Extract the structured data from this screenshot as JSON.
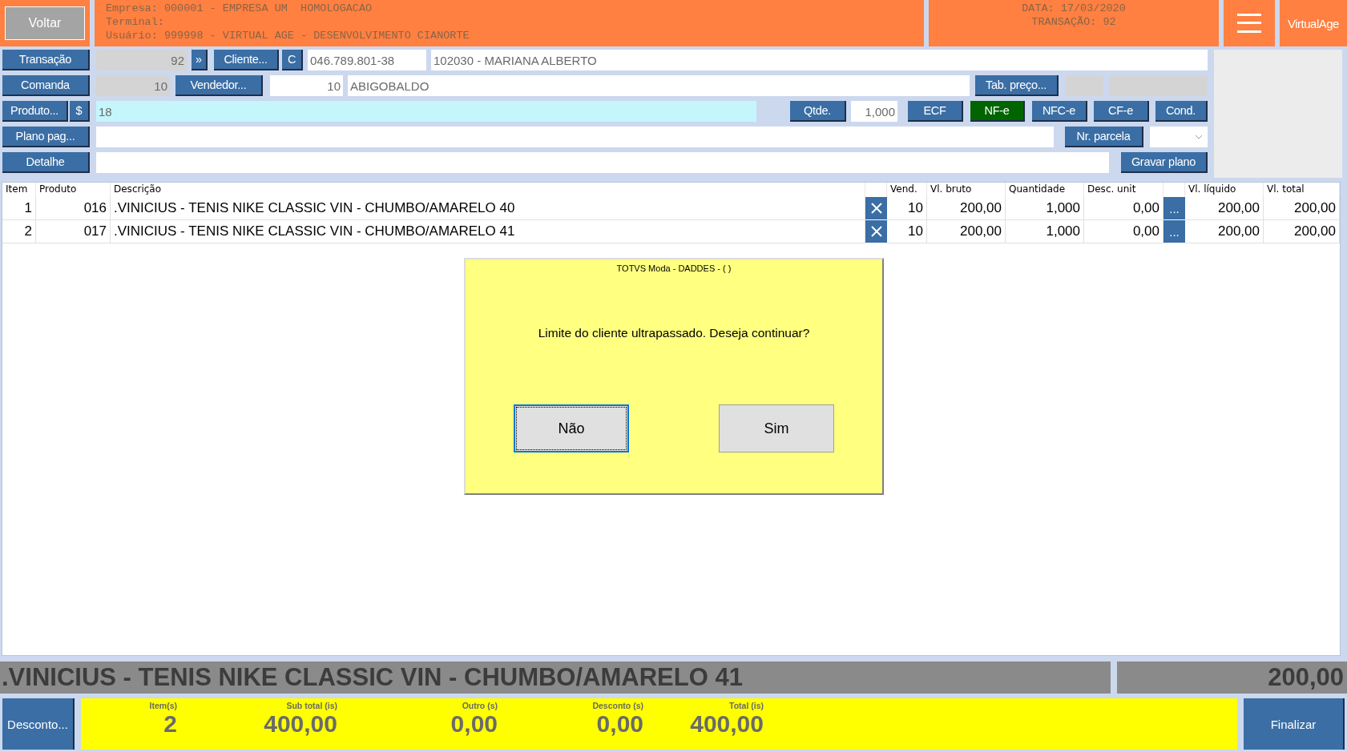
{
  "header": {
    "back_button": "Voltar",
    "info_lines": [
      "Empresa: 000001 - EMPRESA UM  HOMOLOGACAO",
      "Terminal:",
      "Usuário: 999998 - VIRTUAL AGE - DESENVOLVIMENTO CIANORTE"
    ],
    "date_lines": [
      "DATA: 17/03/2020",
      "TRANSAÇÃO: 92"
    ],
    "brand": "VirtualAge"
  },
  "form_rows": [
    {
      "items": [
        {
          "kind": "button",
          "label": "Transação",
          "selected": false
        },
        {
          "kind": "field",
          "value": "92",
          "disabled": true,
          "focused": false
        },
        {
          "kind": "button",
          "label": "»",
          "selected": false
        },
        {
          "kind": "button",
          "label": "Cliente...",
          "selected": false
        },
        {
          "kind": "button",
          "label": "C",
          "selected": false
        },
        {
          "kind": "field",
          "value": "046.789.801-38",
          "disabled": false,
          "focused": false
        },
        {
          "kind": "field",
          "value": "102030 - MARIANA ALBERTO",
          "disabled": false,
          "focused": false
        }
      ]
    },
    {
      "items": [
        {
          "kind": "button",
          "label": "Comanda",
          "selected": false
        },
        {
          "kind": "field",
          "value": "10",
          "disabled": true,
          "focused": false
        },
        {
          "kind": "button",
          "label": "Vendedor...",
          "selected": false
        },
        {
          "kind": "field",
          "value": "10",
          "disabled": false,
          "focused": false
        },
        {
          "kind": "field",
          "value": "ABIGOBALDO",
          "disabled": false,
          "focused": false
        },
        {
          "kind": "button",
          "label": "Tab. preço...",
          "selected": false
        },
        {
          "kind": "field",
          "disabled": true,
          "focused": false
        },
        {
          "kind": "field",
          "disabled": true,
          "focused": false
        }
      ]
    },
    {
      "items": [
        {
          "kind": "button",
          "label": "Produto...",
          "selected": false
        },
        {
          "kind": "button",
          "label": "$",
          "selected": false
        },
        {
          "kind": "field",
          "value": "18",
          "disabled": false,
          "focused": true
        },
        {
          "kind": "button",
          "label": "Qtde.",
          "selected": false
        },
        {
          "kind": "field",
          "value": "1,000",
          "disabled": false,
          "focused": false
        },
        {
          "kind": "button",
          "label": "ECF",
          "selected": false
        },
        {
          "kind": "button",
          "label": "NF-e",
          "selected": true
        },
        {
          "kind": "button",
          "label": "NFC-e",
          "selected": false
        },
        {
          "kind": "button",
          "label": "CF-e",
          "selected": false
        },
        {
          "kind": "button",
          "label": "Cond.",
          "selected": false
        }
      ]
    },
    {
      "items": [
        {
          "kind": "button",
          "label": "Plano pag...",
          "selected": false
        },
        {
          "kind": "field",
          "disabled": false,
          "focused": false
        },
        {
          "kind": "button",
          "label": "Nr. parcela",
          "selected": false
        },
        {
          "kind": "dropdown"
        }
      ]
    },
    {
      "items": [
        {
          "kind": "button",
          "label": "Detalhe",
          "selected": false
        },
        {
          "kind": "field",
          "disabled": false,
          "focused": false
        },
        {
          "kind": "button",
          "label": "Gravar plano",
          "selected": false
        }
      ]
    }
  ],
  "table": {
    "columns": [
      "Item",
      "Produto",
      "Descrição",
      "Vend.",
      "Vl. bruto",
      "Quantidade",
      "Desc. unit",
      "Vl. líquido",
      "Vl. total"
    ],
    "rows": [
      {
        "item": "1",
        "product": "016",
        "description": ".VINICIUS - TENIS NIKE CLASSIC VIN - CHUMBO/AMARELO 40",
        "vend": "10",
        "gross": "200,00",
        "qty": "1,000",
        "discount": "0,00",
        "detail_button": "...",
        "net": "200,00",
        "total": "200,00"
      },
      {
        "item": "2",
        "product": "017",
        "description": ".VINICIUS - TENIS NIKE CLASSIC VIN - CHUMBO/AMARELO 41",
        "vend": "10",
        "gross": "200,00",
        "qty": "1,000",
        "discount": "0,00",
        "detail_button": "...",
        "net": "200,00",
        "total": "200,00"
      }
    ]
  },
  "dialog": {
    "title": "TOTVS Moda - DADDES - (  )",
    "message": "Limite do cliente ultrapassado. Deseja continuar?",
    "buttons": [
      {
        "label": "Não",
        "focused": true
      },
      {
        "label": "Sim",
        "focused": false
      }
    ]
  },
  "status_line": {
    "description": ".VINICIUS - TENIS NIKE CLASSIC VIN - CHUMBO/AMARELO 41",
    "value": "200,00"
  },
  "footer": {
    "discount_button": "Desconto...",
    "totals": [
      {
        "label": "Item(s)",
        "value": "2"
      },
      {
        "label": "Sub total (is)",
        "value": "400,00"
      },
      {
        "label": "Outro (s)",
        "value": "0,00"
      },
      {
        "label": "Desconto (s)",
        "value": "0,00"
      },
      {
        "label": "Total (is)",
        "value": "400,00"
      }
    ],
    "finish_button": "Finalizar"
  }
}
